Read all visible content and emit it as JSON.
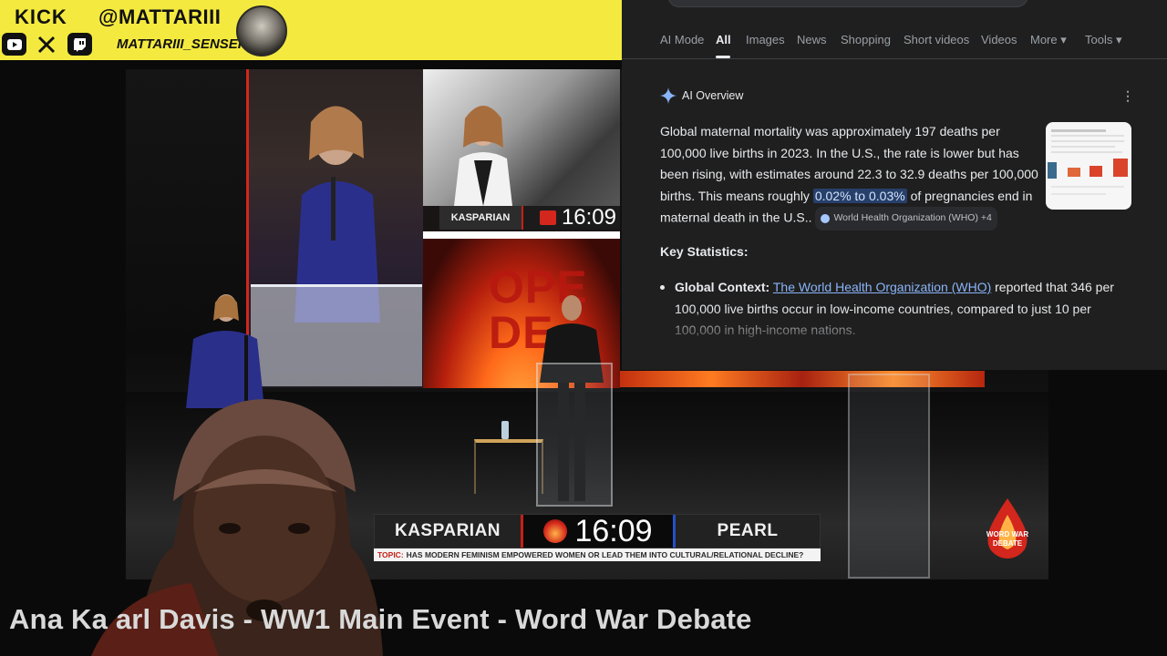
{
  "banner": {
    "kick_label": "KICK",
    "handle": "@MATTARIII",
    "subhandle": "MATTARIII_SENSEI",
    "social_icons": [
      "youtube-icon",
      "x-icon",
      "twitch-icon"
    ],
    "background": "#f4ea3f"
  },
  "video": {
    "title": "Ana Kasparian vs Pearl Davis - WW1 Main Event - Word War Debate",
    "title_visible": "Ana Ka            arl Davis - WW1 Main Event - Word War Debate",
    "left_name": "KASPARIAN",
    "right_name": "PEARL",
    "timer": "16:09",
    "topic_key": "TOPIC:",
    "topic_text": "HAS MODERN FEMINISM EMPOWERED WOMEN OR LEAD THEM INTO CULTURAL/RELATIONAL DECLINE?",
    "screen_name": "KASPARIAN",
    "screen_timer": "16:09",
    "screen_fire_text": "OPE\nDEBA",
    "logo_line1": "WORD WAR",
    "logo_line2": "DEBATE"
  },
  "google": {
    "tabs": [
      {
        "label": "AI Mode",
        "active": false
      },
      {
        "label": "All",
        "active": true
      },
      {
        "label": "Images",
        "active": false
      },
      {
        "label": "News",
        "active": false
      },
      {
        "label": "Shopping",
        "active": false
      },
      {
        "label": "Short videos",
        "active": false
      },
      {
        "label": "Videos",
        "active": false
      },
      {
        "label": "More ▾",
        "active": false
      },
      {
        "label": "Tools ▾",
        "active": false
      }
    ],
    "ai_overview": {
      "title": "AI Overview",
      "text_before": "Global maternal mortality was approximately 197 deaths per 100,000 live births in 2023. In the U.S., the rate is lower but has been rising, with estimates around 22.3 to 32.9 deaths per 100,000 births. This means roughly ",
      "highlight": "0.02% to 0.03%",
      "text_after": " of pregnancies end in maternal death in the U.S.. ",
      "source_chip": "World Health Organization (WHO) +4"
    },
    "key_statistics_title": "Key Statistics:",
    "bullet": {
      "label": "Global Context:",
      "link": "The World Health Organization (WHO)",
      "text": " reported that 346 per 100,000 live births occur in low-income countries, compared to just 10 per 100,000 in high-income nations."
    },
    "colors": {
      "panel": "#1f1f1f",
      "link": "#8ab4f8",
      "highlight": "#27406b"
    }
  }
}
